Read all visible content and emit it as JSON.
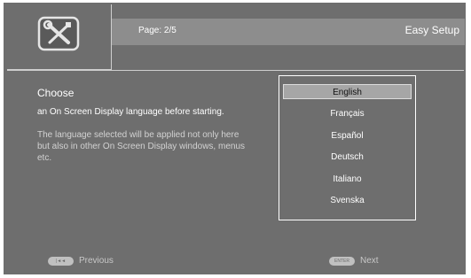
{
  "header": {
    "page_label": "Page: 2/5",
    "title": "Easy Setup",
    "setup_icon": "wrench-screwdriver-icon"
  },
  "instructions": {
    "heading": "Choose",
    "main": "an On Screen Display language before starting.",
    "detail": "The language selected will be applied not only here but also in other On Screen Display windows, menus etc."
  },
  "languages": {
    "items": [
      "English",
      "Français",
      "Español",
      "Deutsch",
      "Italiano",
      "Svenska"
    ],
    "selected": "English"
  },
  "footer": {
    "previous": {
      "key": "|◄◄",
      "label": "Previous"
    },
    "next": {
      "key": "ENTER",
      "label": "Next"
    }
  },
  "colors": {
    "background": "#6e6e6e",
    "header_bar": "#8d8d8d",
    "selected_item": "#a6a6a6"
  }
}
